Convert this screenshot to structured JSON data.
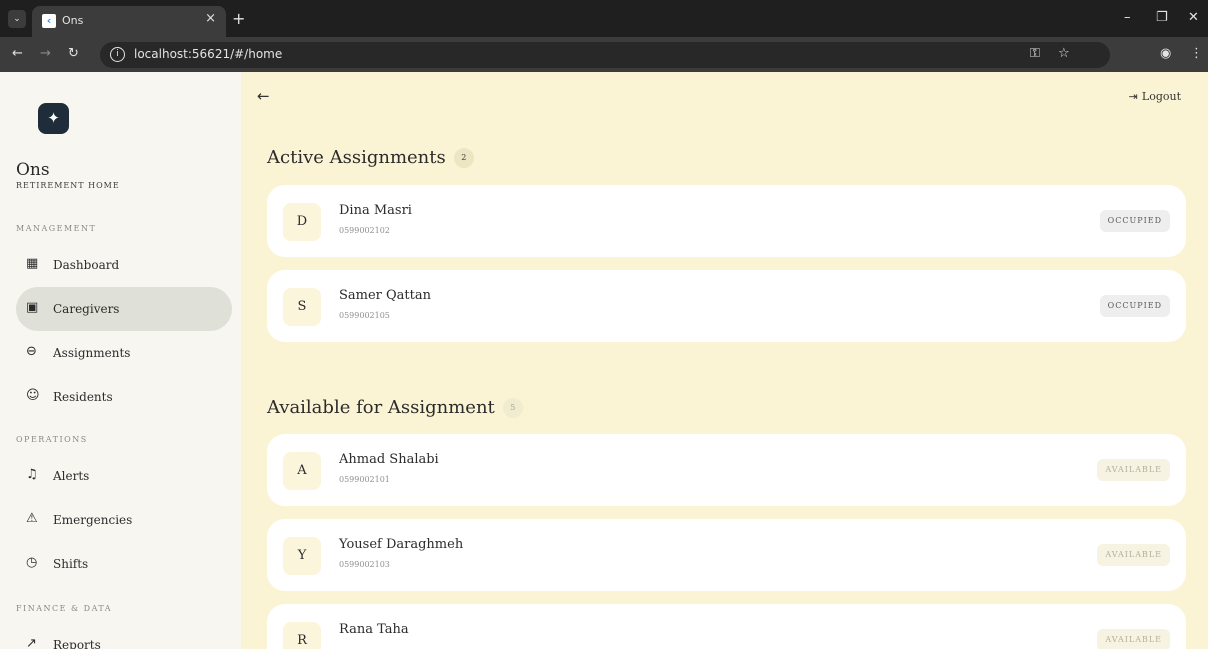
{
  "browser": {
    "tab_title": "Ons",
    "tab_close": "×",
    "new_tab": "+",
    "url": "localhost:56621/#/home",
    "window_controls": {
      "minimize": "–",
      "restore": "❐",
      "close": "✕"
    }
  },
  "sidebar": {
    "brand": "Ons",
    "subtitle": "RETIREMENT HOME",
    "sections": [
      {
        "title": "MANAGEMENT",
        "items": [
          {
            "label": "Dashboard",
            "icon": "grid-icon",
            "active": false
          },
          {
            "label": "Caregivers",
            "icon": "briefcase-icon",
            "active": true
          },
          {
            "label": "Assignments",
            "icon": "link-icon",
            "active": false
          },
          {
            "label": "Residents",
            "icon": "people-icon",
            "active": false
          }
        ]
      },
      {
        "title": "OPERATIONS",
        "items": [
          {
            "label": "Alerts",
            "icon": "bell-icon",
            "active": false
          },
          {
            "label": "Emergencies",
            "icon": "warning-icon",
            "active": false
          },
          {
            "label": "Shifts",
            "icon": "clock-icon",
            "active": false
          }
        ]
      },
      {
        "title": "FINANCE & DATA",
        "items": [
          {
            "label": "Reports",
            "icon": "chart-icon",
            "active": false
          }
        ]
      }
    ]
  },
  "header": {
    "logout_label": "Logout"
  },
  "active": {
    "title": "Active Assignments",
    "count": "2",
    "cards": [
      {
        "initial": "D",
        "name": "Dina Masri",
        "phone": "0599002102",
        "status": "OCCUPIED"
      },
      {
        "initial": "S",
        "name": "Samer Qattan",
        "phone": "0599002105",
        "status": "OCCUPIED"
      }
    ]
  },
  "available": {
    "title": "Available for Assignment",
    "count": "5",
    "cards": [
      {
        "initial": "A",
        "name": "Ahmad Shalabi",
        "phone": "0599002101",
        "status": "AVAILABLE"
      },
      {
        "initial": "Y",
        "name": "Yousef Daraghmeh",
        "phone": "0599002103",
        "status": "AVAILABLE"
      },
      {
        "initial": "R",
        "name": "Rana Taha",
        "phone": "",
        "status": "AVAILABLE"
      }
    ]
  }
}
